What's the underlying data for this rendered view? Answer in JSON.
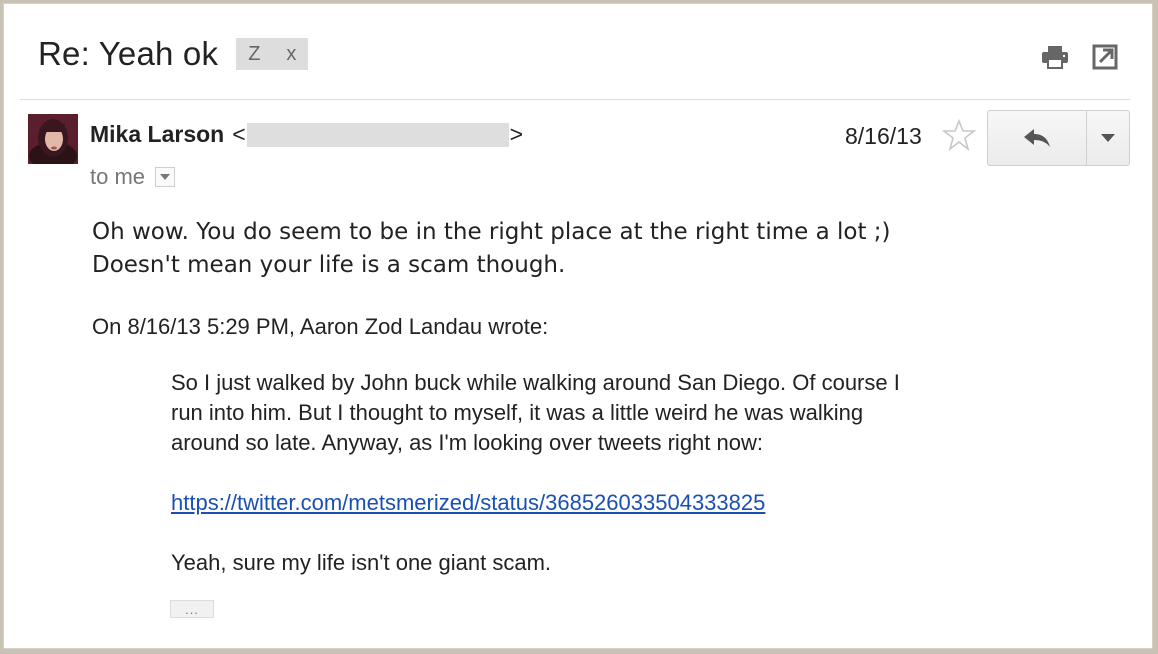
{
  "header": {
    "subject": "Re: Yeah ok",
    "labels": [
      "Z",
      "x"
    ],
    "icons": [
      "print-icon",
      "new-window-icon"
    ]
  },
  "message": {
    "sender_name": "Mika Larson",
    "sender_email_open": "<",
    "sender_email_close": ">",
    "date": "8/16/13",
    "to_label": "to me",
    "body_lines": [
      "Oh wow. You do seem to be in the right place at the right time a lot ;)",
      "Doesn't mean your life is a scam though."
    ],
    "attribution": "On 8/16/13 5:29 PM, Aaron Zod Landau wrote:",
    "quote": {
      "paragraph1": [
        "So I just walked by John buck while walking around San Diego. Of course I",
        "run into him. But I thought to myself, it was a little weird he was walking",
        "around so late. Anyway, as I'm looking over tweets right now:"
      ],
      "link": "https://twitter.com/metsmerized/status/368526033504333825",
      "closing": "Yeah, sure my life isn't one giant scam."
    },
    "trimmed_content_label": "..."
  },
  "colors": {
    "link": "#1a4fb3",
    "label_bg": "#dddddd"
  }
}
